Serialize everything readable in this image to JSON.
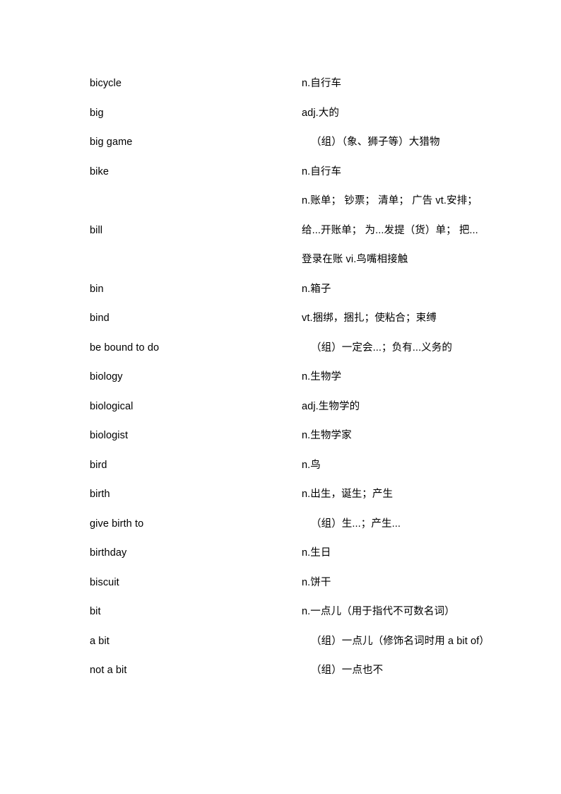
{
  "document": {
    "type": "vocabulary-word-list",
    "page_background": "#ffffff",
    "text_color": "#000000",
    "entries": [
      {
        "term": "bicycle",
        "definition": "n.自行车",
        "phrase": false
      },
      {
        "term": "big",
        "definition": "adj.大的",
        "phrase": false
      },
      {
        "term": "big game",
        "definition": "（组）（象、狮子等）大猎物",
        "phrase": true
      },
      {
        "term": "bike",
        "definition": "n.自行车",
        "phrase": false
      },
      {
        "term": "bill",
        "definition": "n.账单； 钞票； 清单； 广告 vt.安排； 给...开账单； 为...发提（货）单； 把...登录在账 vi.鸟嘴相接触",
        "phrase": false
      },
      {
        "term": "bin",
        "definition": "n.箱子",
        "phrase": false
      },
      {
        "term": "bind",
        "definition": "vt.捆绑，捆扎；使粘合；束缚",
        "phrase": false
      },
      {
        "term": "be bound to do",
        "definition": "（组）一定会...；负有...义务的",
        "phrase": true
      },
      {
        "term": "biology",
        "definition": "n.生物学",
        "phrase": false
      },
      {
        "term": "biological",
        "definition": "adj.生物学的",
        "phrase": false
      },
      {
        "term": "biologist",
        "definition": "n.生物学家",
        "phrase": false
      },
      {
        "term": "bird",
        "definition": "n.鸟",
        "phrase": false
      },
      {
        "term": "birth",
        "definition": "n.出生，诞生；产生",
        "phrase": false
      },
      {
        "term": "give birth to",
        "definition": "（组）生...；产生...",
        "phrase": true
      },
      {
        "term": "birthday",
        "definition": "n.生日",
        "phrase": false
      },
      {
        "term": "biscuit",
        "definition": "n.饼干",
        "phrase": false
      },
      {
        "term": "bit",
        "definition": "n.一点儿（用于指代不可数名词）",
        "phrase": false
      },
      {
        "term": "a bit",
        "definition": "（组）一点儿（修饰名词时用 a bit of）",
        "phrase": true
      },
      {
        "term": "not a bit",
        "definition": "（组）一点也不",
        "phrase": true
      }
    ]
  }
}
